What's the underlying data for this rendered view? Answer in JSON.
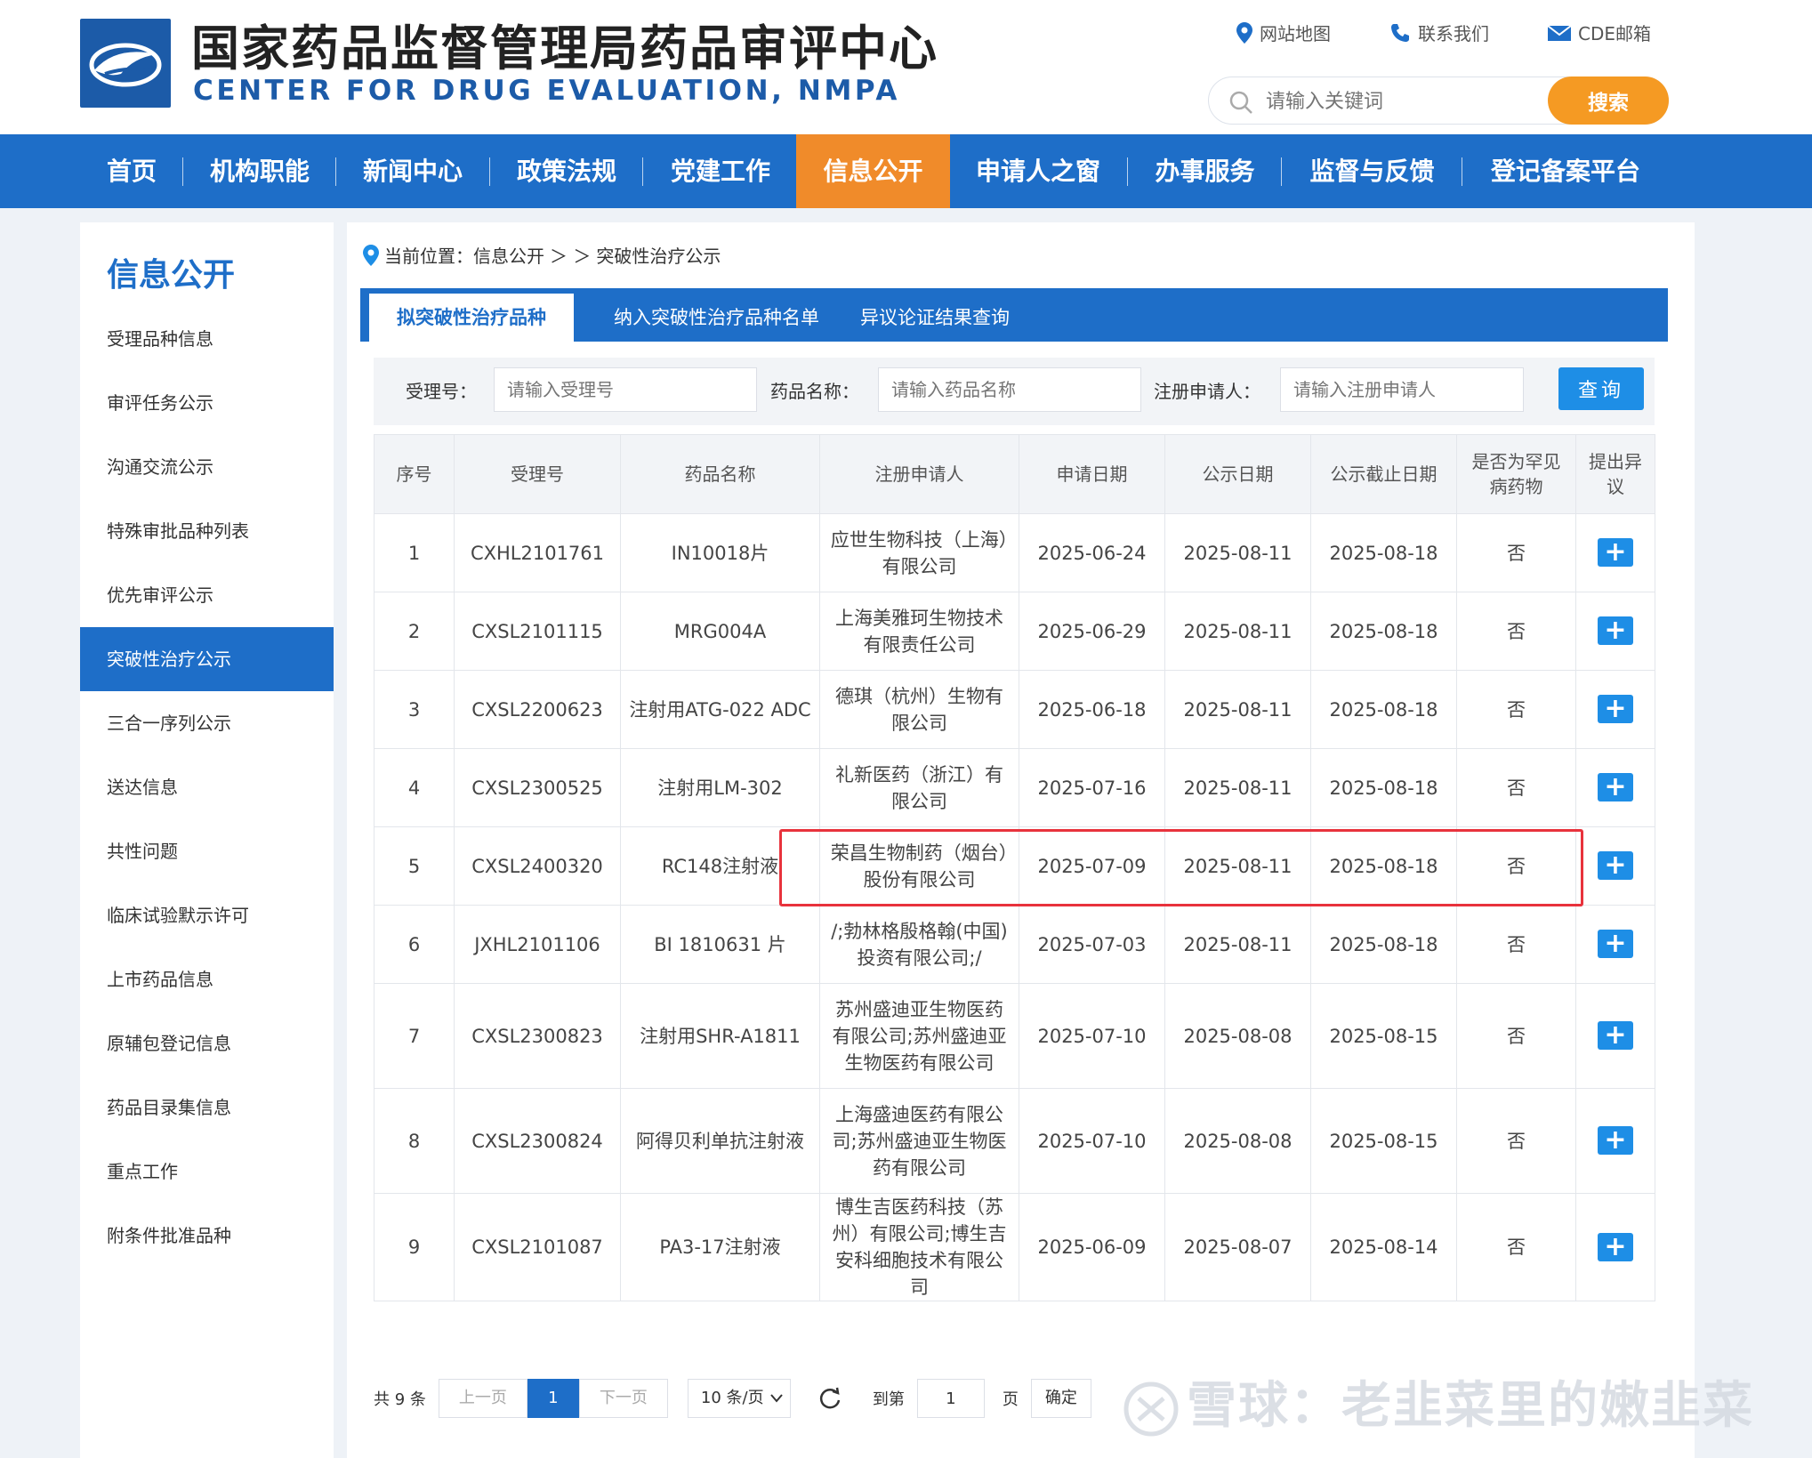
{
  "header": {
    "title": "国家药品监督管理局药品审评中心",
    "subtitle": "CENTER FOR DRUG EVALUATION, NMPA",
    "links": [
      "网站地图",
      "联系我们",
      "CDE邮箱"
    ],
    "search_placeholder": "请输入关键词",
    "search_button": "搜索"
  },
  "nav": [
    "首页",
    "机构职能",
    "新闻中心",
    "政策法规",
    "党建工作",
    "信息公开",
    "申请人之窗",
    "办事服务",
    "监督与反馈",
    "登记备案平台"
  ],
  "nav_active": "信息公开",
  "sidebar": {
    "title": "信息公开",
    "items": [
      "受理品种信息",
      "审评任务公示",
      "沟通交流公示",
      "特殊审批品种列表",
      "优先审评公示",
      "突破性治疗公示",
      "三合一序列公示",
      "送达信息",
      "共性问题",
      "临床试验默示许可",
      "上市药品信息",
      "原辅包登记信息",
      "药品目录集信息",
      "重点工作",
      "附条件批准品种"
    ],
    "active": "突破性治疗公示"
  },
  "breadcrumb": {
    "prefix": "当前位置：信息公开",
    "sep": "＞ ＞",
    "current": "突破性治疗公示"
  },
  "tabs": [
    "拟突破性治疗品种",
    "纳入突破性治疗品种名单",
    "异议论证结果查询"
  ],
  "filter": {
    "label1": "受理号：",
    "placeholder1": "请输入受理号",
    "label2": "药品名称：",
    "placeholder2": "请输入药品名称",
    "label3": "注册申请人：",
    "placeholder3": "请输入注册申请人",
    "button": "查询"
  },
  "table": {
    "headers": [
      "序号",
      "受理号",
      "药品名称",
      "注册申请人",
      "申请日期",
      "公示日期",
      "公示截止日期",
      "是否为罕见病药物",
      "提出异议"
    ],
    "rows": [
      {
        "no": "1",
        "code": "CXHL2101761",
        "name": "IN10018片",
        "applicant": "应世生物科技（上海）有限公司",
        "apply": "2025-06-24",
        "pub": "2025-08-11",
        "end": "2025-08-18",
        "rare": "否"
      },
      {
        "no": "2",
        "code": "CXSL2101115",
        "name": "MRG004A",
        "applicant": "上海美雅珂生物技术有限责任公司",
        "apply": "2025-06-29",
        "pub": "2025-08-11",
        "end": "2025-08-18",
        "rare": "否"
      },
      {
        "no": "3",
        "code": "CXSL2200623",
        "name": "注射用ATG-022 ADC",
        "applicant": "德琪（杭州）生物有限公司",
        "apply": "2025-06-18",
        "pub": "2025-08-11",
        "end": "2025-08-18",
        "rare": "否"
      },
      {
        "no": "4",
        "code": "CXSL2300525",
        "name": "注射用LM-302",
        "applicant": "礼新医药（浙江）有限公司",
        "apply": "2025-07-16",
        "pub": "2025-08-11",
        "end": "2025-08-18",
        "rare": "否"
      },
      {
        "no": "5",
        "code": "CXSL2400320",
        "name": "RC148注射液",
        "applicant": "荣昌生物制药（烟台）股份有限公司",
        "apply": "2025-07-09",
        "pub": "2025-08-11",
        "end": "2025-08-18",
        "rare": "否"
      },
      {
        "no": "6",
        "code": "JXHL2101106",
        "name": "BI 1810631 片",
        "applicant": "/;勃林格殷格翰(中国)投资有限公司;/",
        "apply": "2025-07-03",
        "pub": "2025-08-11",
        "end": "2025-08-18",
        "rare": "否"
      },
      {
        "no": "7",
        "code": "CXSL2300823",
        "name": "注射用SHR-A1811",
        "applicant": "苏州盛迪亚生物医药有限公司;苏州盛迪亚生物医药有限公司",
        "apply": "2025-07-10",
        "pub": "2025-08-08",
        "end": "2025-08-15",
        "rare": "否"
      },
      {
        "no": "8",
        "code": "CXSL2300824",
        "name": "阿得贝利单抗注射液",
        "applicant": "上海盛迪医药有限公司;苏州盛迪亚生物医药有限公司",
        "apply": "2025-07-10",
        "pub": "2025-08-08",
        "end": "2025-08-15",
        "rare": "否"
      },
      {
        "no": "9",
        "code": "CXSL2101087",
        "name": "PA3-17注射液",
        "applicant": "博生吉医药科技（苏州）有限公司;博生吉安科细胞技术有限公司",
        "apply": "2025-06-09",
        "pub": "2025-08-07",
        "end": "2025-08-14",
        "rare": "否"
      }
    ],
    "action_symbol": "+"
  },
  "pager": {
    "total": "共 9 条",
    "prev": "上一页",
    "current": "1",
    "next": "下一页",
    "size": "10 条/页",
    "goto": "到第",
    "goto_value": "1",
    "page_word": "页",
    "confirm": "确定"
  },
  "watermark": "雪球：老韭菜里的嫩韭菜",
  "colors": {
    "brand": "#1e6ec8",
    "accent": "#f08b2a",
    "highlight": "#e8323c"
  }
}
